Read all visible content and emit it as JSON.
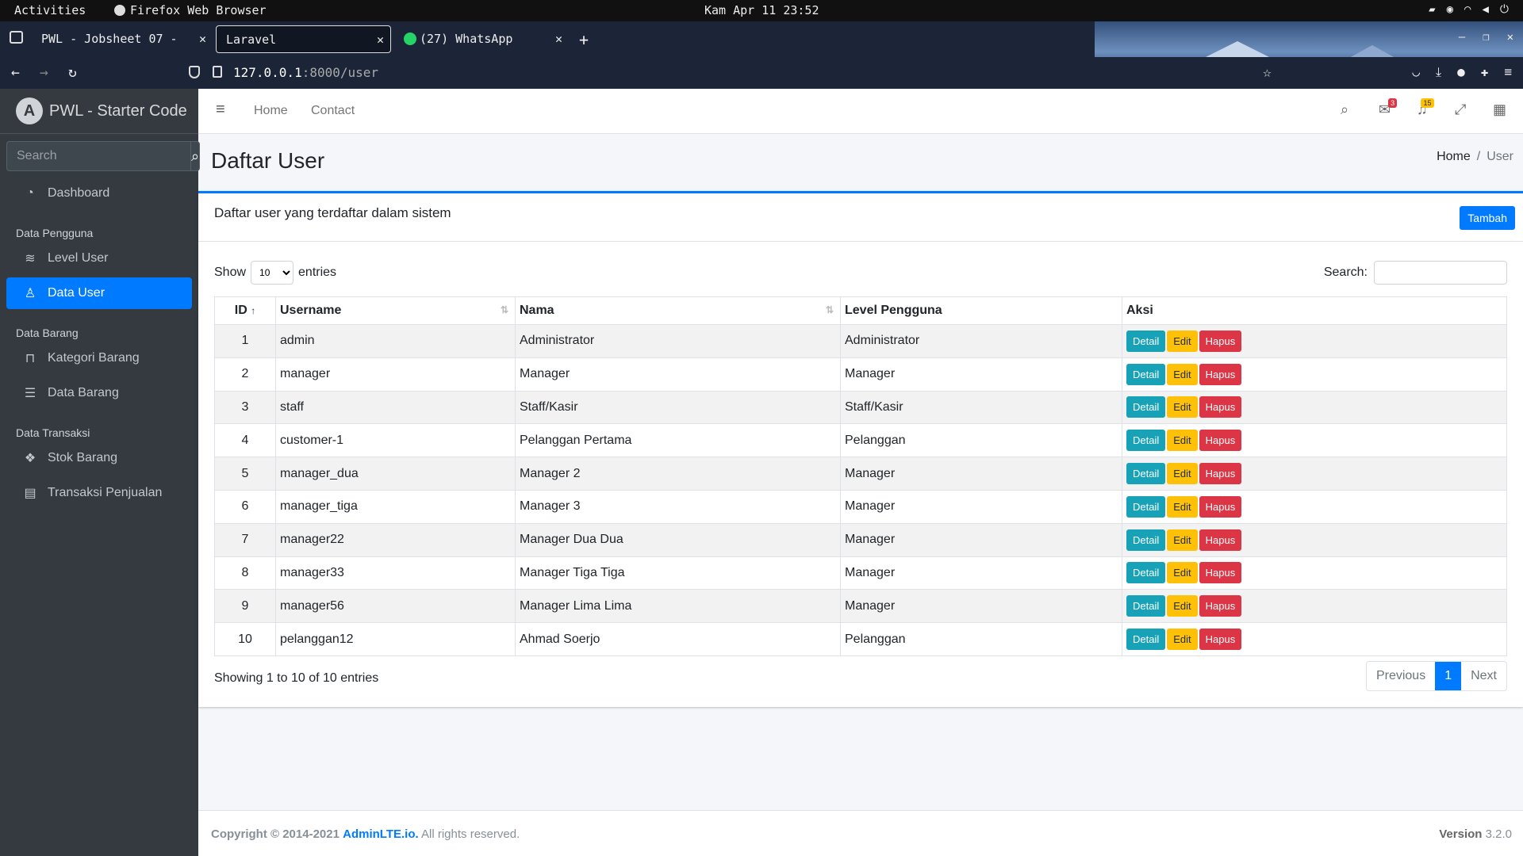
{
  "system": {
    "activities": "Activities",
    "app_name": "Firefox Web Browser",
    "clock": "Kam Apr 11 23:52"
  },
  "browser": {
    "tabs": [
      {
        "label": "PWL - Jobsheet 07 - "
      },
      {
        "label": "Laravel"
      },
      {
        "label": "(27) WhatsApp"
      }
    ],
    "url_host": "127.0.0.1",
    "url_rest": ":8000/user"
  },
  "sidebar": {
    "brand": "PWL - Starter Code",
    "search_placeholder": "Search",
    "dashboard": "Dashboard",
    "header_pengguna": "Data Pengguna",
    "level_user": "Level User",
    "data_user": "Data User",
    "header_barang": "Data Barang",
    "kategori_barang": "Kategori Barang",
    "data_barang": "Data Barang",
    "header_transaksi": "Data Transaksi",
    "stok_barang": "Stok Barang",
    "transaksi_penjualan": "Transaksi Penjualan"
  },
  "topnav": {
    "home": "Home",
    "contact": "Contact",
    "messages_badge": "3",
    "notifications_badge": "15"
  },
  "page": {
    "title": "Daftar User",
    "breadcrumb_home": "Home",
    "breadcrumb_current": "User"
  },
  "card": {
    "title": "Daftar user yang terdaftar dalam sistem",
    "add_button": "Tambah",
    "show_label": "Show",
    "entries_label": "entries",
    "length_value": "10",
    "search_label": "Search:",
    "info": "Showing 1 to 10 of 10 entries",
    "prev": "Previous",
    "page": "1",
    "next": "Next"
  },
  "table": {
    "headers": [
      "ID",
      "Username",
      "Nama",
      "Level Pengguna",
      "Aksi"
    ],
    "rows": [
      {
        "id": "1",
        "username": "admin",
        "nama": "Administrator",
        "level": "Administrator"
      },
      {
        "id": "2",
        "username": "manager",
        "nama": "Manager",
        "level": "Manager"
      },
      {
        "id": "3",
        "username": "staff",
        "nama": "Staff/Kasir",
        "level": "Staff/Kasir"
      },
      {
        "id": "4",
        "username": "customer-1",
        "nama": "Pelanggan Pertama",
        "level": "Pelanggan"
      },
      {
        "id": "5",
        "username": "manager_dua",
        "nama": "Manager 2",
        "level": "Manager"
      },
      {
        "id": "6",
        "username": "manager_tiga",
        "nama": "Manager 3",
        "level": "Manager"
      },
      {
        "id": "7",
        "username": "manager22",
        "nama": "Manager Dua Dua",
        "level": "Manager"
      },
      {
        "id": "8",
        "username": "manager33",
        "nama": "Manager Tiga Tiga",
        "level": "Manager"
      },
      {
        "id": "9",
        "username": "manager56",
        "nama": "Manager Lima Lima",
        "level": "Manager"
      },
      {
        "id": "10",
        "username": "pelanggan12",
        "nama": "Ahmad Soerjo",
        "level": "Pelanggan"
      }
    ],
    "btn_detail": "Detail",
    "btn_edit": "Edit",
    "btn_hapus": "Hapus"
  },
  "footer": {
    "copyright": "Copyright © 2014-2021",
    "link": "AdminLTE.io.",
    "rights": "All rights reserved.",
    "version_label": "Version",
    "version": "3.2.0"
  }
}
